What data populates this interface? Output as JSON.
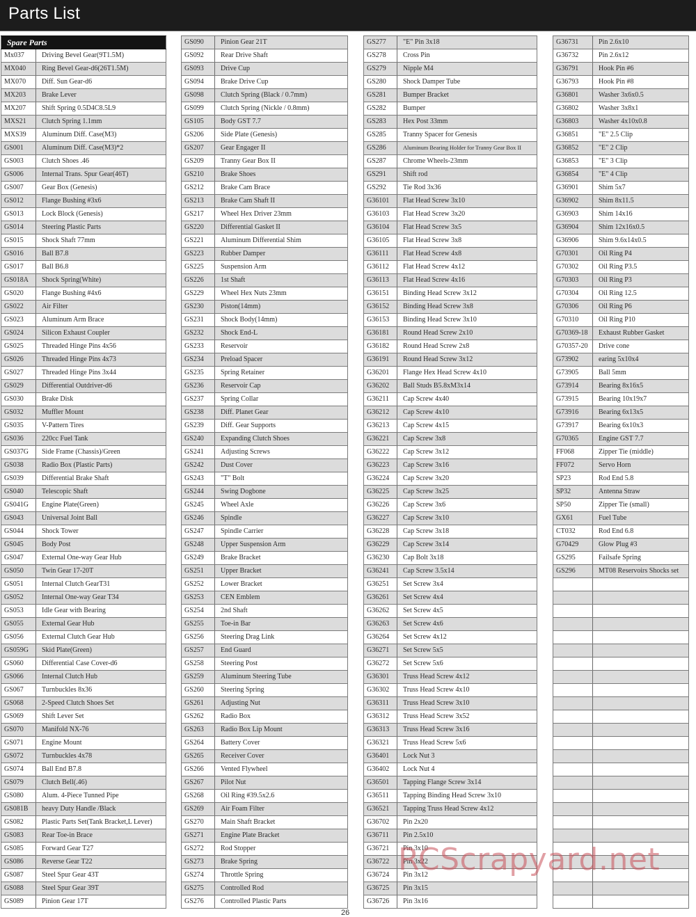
{
  "header": {
    "title": "Parts List"
  },
  "section_title": "Spare Parts",
  "page_number": "26",
  "watermark": "RCScrapyard.net",
  "columns": [
    {
      "first_row_shaded": false,
      "rows": [
        [
          "Mx037",
          "Driving Bevel Gear(9T1.5M)"
        ],
        [
          "MX040",
          "Ring Bevel Gear-d6(26T1.5M)"
        ],
        [
          "MX070",
          "Diff. Sun Gear-d6"
        ],
        [
          "MX203",
          "Brake Lever"
        ],
        [
          "MX207",
          "Shift Spring 0.5D4C8.5L9"
        ],
        [
          "MXS21",
          "Clutch Spring 1.1mm"
        ],
        [
          "MXS39",
          "Aluminum Diff. Case(M3)"
        ],
        [
          "GS001",
          "Aluminum Diff. Case(M3)*2"
        ],
        [
          "GS003",
          "Clutch Shoes .46"
        ],
        [
          "GS006",
          "Internal Trans. Spur Gear(46T)"
        ],
        [
          "GS007",
          "Gear Box (Genesis)"
        ],
        [
          "GS012",
          "Flange Bushing #3x6"
        ],
        [
          "GS013",
          "Lock Block (Genesis)"
        ],
        [
          "GS014",
          "Steering Plastic Parts"
        ],
        [
          "GS015",
          "Shock Shaft 77mm"
        ],
        [
          "GS016",
          "Ball B7.8"
        ],
        [
          "GS017",
          "Ball B6.8"
        ],
        [
          "GS018A",
          "Shock Spring(White)"
        ],
        [
          "GS020",
          "Flange Bushing #4x6"
        ],
        [
          "GS022",
          "Air Filter"
        ],
        [
          "GS023",
          "Aluminum Arm Brace"
        ],
        [
          "GS024",
          "Silicon Exhaust Coupler"
        ],
        [
          "GS025",
          "Threaded Hinge  Pins 4x56"
        ],
        [
          "GS026",
          "Threaded Hinge  Pins 4x73"
        ],
        [
          "GS027",
          "Threaded Hinge  Pins 3x44"
        ],
        [
          "GS029",
          "Differential Outdriver-d6"
        ],
        [
          "GS030",
          "Brake Disk"
        ],
        [
          "GS032",
          "Muffler Mount"
        ],
        [
          "GS035",
          "V-Pattern Tires"
        ],
        [
          "GS036",
          "220cc Fuel Tank"
        ],
        [
          "GS037G",
          "Side Frame (Chassis)/Green"
        ],
        [
          "GS038",
          "Radio Box (Plastic Parts)"
        ],
        [
          "GS039",
          "Differential Brake Shaft"
        ],
        [
          "GS040",
          "Telescopic Shaft"
        ],
        [
          "GS041G",
          "Engine Plate(Green)"
        ],
        [
          "GS043",
          "Universal Joint Ball"
        ],
        [
          "GS044",
          "Shock Tower"
        ],
        [
          "GS045",
          "Body Post"
        ],
        [
          "GS047",
          "External One-way Gear Hub"
        ],
        [
          "GS050",
          "Twin Gear 17-20T"
        ],
        [
          "GS051",
          "Internal Clutch  GearT31"
        ],
        [
          "GS052",
          "Internal One-way Gear T34"
        ],
        [
          "GS053",
          "Idle Gear with Bearing"
        ],
        [
          "GS055",
          "External Gear Hub"
        ],
        [
          "GS056",
          "External Clutch Gear Hub"
        ],
        [
          "GS059G",
          "Skid  Plate(Green)"
        ],
        [
          "GS060",
          "Differential Case Cover-d6"
        ],
        [
          "GS066",
          "Internal Clutch Hub"
        ],
        [
          "GS067",
          "Turnbuckles 8x36"
        ],
        [
          "GS068",
          "2-Speed Clutch Shoes Set"
        ],
        [
          "GS069",
          "Shift Lever Set"
        ],
        [
          "GS070",
          "Manifold NX-76"
        ],
        [
          "GS071",
          "Engine Mount"
        ],
        [
          "GS072",
          "Turnbuckles 4x78"
        ],
        [
          "GS074",
          "Ball End B7.8"
        ],
        [
          "GS079",
          "Clutch Bell(.46)"
        ],
        [
          "GS080",
          "Alum. 4-Piece Tunned Pipe"
        ],
        [
          "GS081B",
          "heavy Duty Handle /Black"
        ],
        [
          "GS082",
          "Plastic Parts Set(Tank Bracket,L Lever)"
        ],
        [
          "GS083",
          "Rear Toe-in Brace"
        ],
        [
          "GS085",
          "Forward Gear T27"
        ],
        [
          "GS086",
          "Reverse Gear T22"
        ],
        [
          "GS087",
          "Steel Spur Gear 43T"
        ],
        [
          "GS088",
          "Steel Spur Gear 39T"
        ],
        [
          "GS089",
          "Pinion Gear 17T"
        ]
      ]
    },
    {
      "first_row_shaded": true,
      "rows": [
        [
          "GS090",
          "Pinion Gear 21T"
        ],
        [
          "GS092",
          "Rear  Drive Shaft"
        ],
        [
          "GS093",
          "Drive Cup"
        ],
        [
          "GS094",
          "Brake Drive Cup"
        ],
        [
          "GS098",
          "Clutch Spring (Black / 0.7mm)"
        ],
        [
          "GS099",
          "Clutch Spring (Nickle / 0.8mm)"
        ],
        [
          "GS105",
          "Body GST 7.7"
        ],
        [
          "GS206",
          "Side Plate (Genesis)"
        ],
        [
          "GS207",
          "Gear Engager II"
        ],
        [
          "GS209",
          "Tranny Gear Box II"
        ],
        [
          "GS210",
          "Brake Shoes"
        ],
        [
          "GS212",
          "Brake Cam Brace"
        ],
        [
          "GS213",
          "Brake Cam Shaft II"
        ],
        [
          "GS217",
          "Wheel Hex Driver 23mm"
        ],
        [
          "GS220",
          "Differential Gasket II"
        ],
        [
          "GS221",
          "Aluminum Differential Shim"
        ],
        [
          "GS223",
          "Rubber  Damper"
        ],
        [
          "GS225",
          "Suspension Arm"
        ],
        [
          "GS226",
          "1st Shaft"
        ],
        [
          "GS229",
          "Wheel Hex Nuts 23mm"
        ],
        [
          "GS230",
          "Piston(14mm)"
        ],
        [
          "GS231",
          "Shock Body(14mm)"
        ],
        [
          "GS232",
          "Shock End-L"
        ],
        [
          "GS233",
          "Reservoir"
        ],
        [
          "GS234",
          "Preload Spacer"
        ],
        [
          "GS235",
          "Spring Retainer"
        ],
        [
          "GS236",
          "Reservoir Cap"
        ],
        [
          "GS237",
          "Spring Collar"
        ],
        [
          "GS238",
          "Diff. Planet Gear"
        ],
        [
          "GS239",
          "Diff. Gear Supports"
        ],
        [
          "GS240",
          "Expanding Clutch Shoes"
        ],
        [
          "GS241",
          "Adjusting Screws"
        ],
        [
          "GS242",
          "Dust Cover"
        ],
        [
          "GS243",
          "\"T\" Bolt"
        ],
        [
          "GS244",
          "Swing Dogbone"
        ],
        [
          "GS245",
          "Wheel Axle"
        ],
        [
          "GS246",
          "Spindle"
        ],
        [
          "GS247",
          "Spindle Carrier"
        ],
        [
          "GS248",
          "Upper Suspension Arm"
        ],
        [
          "GS249",
          "Brake Bracket"
        ],
        [
          "GS251",
          "Upper Bracket"
        ],
        [
          "GS252",
          "Lower Bracket"
        ],
        [
          "GS253",
          "CEN Emblem"
        ],
        [
          "GS254",
          "2nd Shaft"
        ],
        [
          "GS255",
          "Toe-in Bar"
        ],
        [
          "GS256",
          "Steering Drag Link"
        ],
        [
          "GS257",
          "End Guard"
        ],
        [
          "GS258",
          "Steering Post"
        ],
        [
          "GS259",
          "Aluminum Steering Tube"
        ],
        [
          "GS260",
          "Steering Spring"
        ],
        [
          "GS261",
          "Adjusting Nut"
        ],
        [
          "GS262",
          "Radio Box"
        ],
        [
          "GS263",
          "Radio Box Lip Mount"
        ],
        [
          "GS264",
          "Battery Cover"
        ],
        [
          "GS265",
          "Receiver Cover"
        ],
        [
          "GS266",
          "Vented Flywheel"
        ],
        [
          "GS267",
          "Pilot Nut"
        ],
        [
          "GS268",
          "Oil Ring #39.5x2.6"
        ],
        [
          "GS269",
          "Air Foam Filter"
        ],
        [
          "GS270",
          "Main Shaft Bracket"
        ],
        [
          "GS271",
          "Engine Plate Bracket"
        ],
        [
          "GS272",
          "Rod Stopper"
        ],
        [
          "GS273",
          "Brake Spring"
        ],
        [
          "GS274",
          "Throttle Spring"
        ],
        [
          "GS275",
          "Controlled Rod"
        ],
        [
          "GS276",
          "Controlled Plastic Parts"
        ]
      ]
    },
    {
      "first_row_shaded": true,
      "rows": [
        [
          "GS277",
          "\"E\" Pin 3x18"
        ],
        [
          "GS278",
          "Cross Pin"
        ],
        [
          "GS279",
          "Nipple M4"
        ],
        [
          "GS280",
          "Shock Damper Tube"
        ],
        [
          "GS281",
          "Bumper Bracket"
        ],
        [
          "GS282",
          "Bumper"
        ],
        [
          "GS283",
          "Hex Post 33mm"
        ],
        [
          "GS285",
          "Tranny Spacer for Genesis"
        ],
        [
          "GS286",
          "Aluminum Bearing Holder for Tranny Gear Box II"
        ],
        [
          "GS287",
          "Chrome Wheels-23mm"
        ],
        [
          "GS291",
          "Shift rod"
        ],
        [
          "GS292",
          "Tie Rod 3x36"
        ],
        [
          "G36101",
          "Flat Head Screw 3x10"
        ],
        [
          "G36103",
          "Flat Head Screw 3x20"
        ],
        [
          "G36104",
          "Flat Head Screw 3x5"
        ],
        [
          "G36105",
          "Flat Head Screw 3x8"
        ],
        [
          "G36111",
          "Flat Head Screw 4x8"
        ],
        [
          "G36112",
          "Flat Head Screw 4x12"
        ],
        [
          "G36113",
          "Flat Head Screw 4x16"
        ],
        [
          "G36151",
          "Binding Head Screw 3x12"
        ],
        [
          "G36152",
          "Binding Head Screw 3x8"
        ],
        [
          "G36153",
          "Binding Head Screw 3x10"
        ],
        [
          "G36181",
          "Round Head Screw 2x10"
        ],
        [
          "G36182",
          "Round Head Screw 2x8"
        ],
        [
          "G36191",
          "Round Head Screw 3x12"
        ],
        [
          "G36201",
          "Flange Hex Head Screw 4x10"
        ],
        [
          "G36202",
          "Ball Studs B5.8xM3x14"
        ],
        [
          "G36211",
          "Cap Screw 4x40"
        ],
        [
          "G36212",
          "Cap Screw 4x10"
        ],
        [
          "G36213",
          "Cap Screw 4x15"
        ],
        [
          "G36221",
          "Cap Screw 3x8"
        ],
        [
          "G36222",
          "Cap Screw 3x12"
        ],
        [
          "G36223",
          "Cap Screw 3x16"
        ],
        [
          "G36224",
          "Cap Screw 3x20"
        ],
        [
          "G36225",
          "Cap Screw 3x25"
        ],
        [
          "G36226",
          "Cap Screw 3x6"
        ],
        [
          "G36227",
          "Cap Screw 3x10"
        ],
        [
          "G36228",
          "Cap Screw 3x18"
        ],
        [
          "G36229",
          "Cap Screw 3x14"
        ],
        [
          "G36230",
          "Cap Bolt 3x18"
        ],
        [
          "G36241",
          "Cap Screw 3.5x14"
        ],
        [
          "G36251",
          "Set Screw 3x4"
        ],
        [
          "G36261",
          "Set Screw 4x4"
        ],
        [
          "G36262",
          "Set Screw 4x5"
        ],
        [
          "G36263",
          "Set Screw 4x6"
        ],
        [
          "G36264",
          "Set Screw 4x12"
        ],
        [
          "G36271",
          "Set Screw 5x5"
        ],
        [
          "G36272",
          "Set Screw 5x6"
        ],
        [
          "G36301",
          "Truss Head Screw 4x12"
        ],
        [
          "G36302",
          "Truss Head Screw 4x10"
        ],
        [
          "G36311",
          "Truss Head Screw 3x10"
        ],
        [
          "G36312",
          "Truss Head Screw 3x52"
        ],
        [
          "G36313",
          "Truss Head Screw 3x16"
        ],
        [
          "G36321",
          "Truss Head Screw 5x6"
        ],
        [
          "G36401",
          "Lock Nut 3"
        ],
        [
          "G36402",
          "Lock Nut 4"
        ],
        [
          "G36501",
          "Tapping Flange Screw 3x14"
        ],
        [
          "G36511",
          "Tapping Binding Head Screw 3x10"
        ],
        [
          "G36521",
          "Tapping Truss Head Screw 4x12"
        ],
        [
          "G36702",
          "Pin 2x20"
        ],
        [
          "G36711",
          "Pin 2.5x10"
        ],
        [
          "G36721",
          "Pin 3x10"
        ],
        [
          "G36722",
          "Pin 3x22"
        ],
        [
          "G36724",
          "Pin 3x12"
        ],
        [
          "G36725",
          "Pin 3x15"
        ],
        [
          "G36726",
          "Pin 3x16"
        ]
      ]
    },
    {
      "first_row_shaded": true,
      "empty_rows": 25,
      "rows": [
        [
          "G36731",
          "Pin 2.6x10"
        ],
        [
          "G36732",
          "Pin 2.6x12"
        ],
        [
          "G36791",
          "Hook Pin #6"
        ],
        [
          "G36793",
          "Hook Pin #8"
        ],
        [
          "G36801",
          "Washer 3x6x0.5"
        ],
        [
          "G36802",
          "Washer 3x8x1"
        ],
        [
          "G36803",
          "Washer 4x10x0.8"
        ],
        [
          "G36851",
          "\"E\" 2.5 Clip"
        ],
        [
          "G36852",
          "\"E\" 2 Clip"
        ],
        [
          "G36853",
          "\"E\" 3 Clip"
        ],
        [
          "G36854",
          "\"E\" 4 Clip"
        ],
        [
          "G36901",
          "Shim 5x7"
        ],
        [
          "G36902",
          "Shim 8x11.5"
        ],
        [
          "G36903",
          "Shim 14x16"
        ],
        [
          "G36904",
          "Shim 12x16x0.5"
        ],
        [
          "G36906",
          "Shim 9.6x14x0.5"
        ],
        [
          "G70301",
          "Oil Ring P4"
        ],
        [
          "G70302",
          "Oil Ring P3.5"
        ],
        [
          "G70303",
          "Oil Ring P3"
        ],
        [
          "G70304",
          "Oil Ring 12.5"
        ],
        [
          "G70306",
          "Oil Ring P6"
        ],
        [
          "G70310",
          "Oil Ring P10"
        ],
        [
          "G70369-18",
          "Exhaust Rubber Gasket"
        ],
        [
          "G70357-20",
          "Drive cone"
        ],
        [
          "G73902",
          "earing 5x10x4"
        ],
        [
          "G73905",
          "Ball 5mm"
        ],
        [
          "G73914",
          "Bearing 8x16x5"
        ],
        [
          "G73915",
          "Bearing 10x19x7"
        ],
        [
          "G73916",
          "Bearing 6x13x5"
        ],
        [
          "G73917",
          "Bearing 6x10x3"
        ],
        [
          "G70365",
          "Engine GST 7.7"
        ],
        [
          "FF068",
          "Zipper Tie (middle)"
        ],
        [
          "FF072",
          "Servo Horn"
        ],
        [
          "SP23",
          "Rod End 5.8"
        ],
        [
          "SP32",
          "Antenna Straw"
        ],
        [
          "SP50",
          "Zipper Tie (small)"
        ],
        [
          "GX61",
          "Fuel Tube"
        ],
        [
          "CT032",
          "Rod End 6.8"
        ],
        [
          "G70429",
          "Glow Plug #3"
        ],
        [
          "GS295",
          "Failsafe Spring"
        ],
        [
          "GS296",
          "MT08 Reservoirs Shocks set"
        ]
      ]
    }
  ]
}
